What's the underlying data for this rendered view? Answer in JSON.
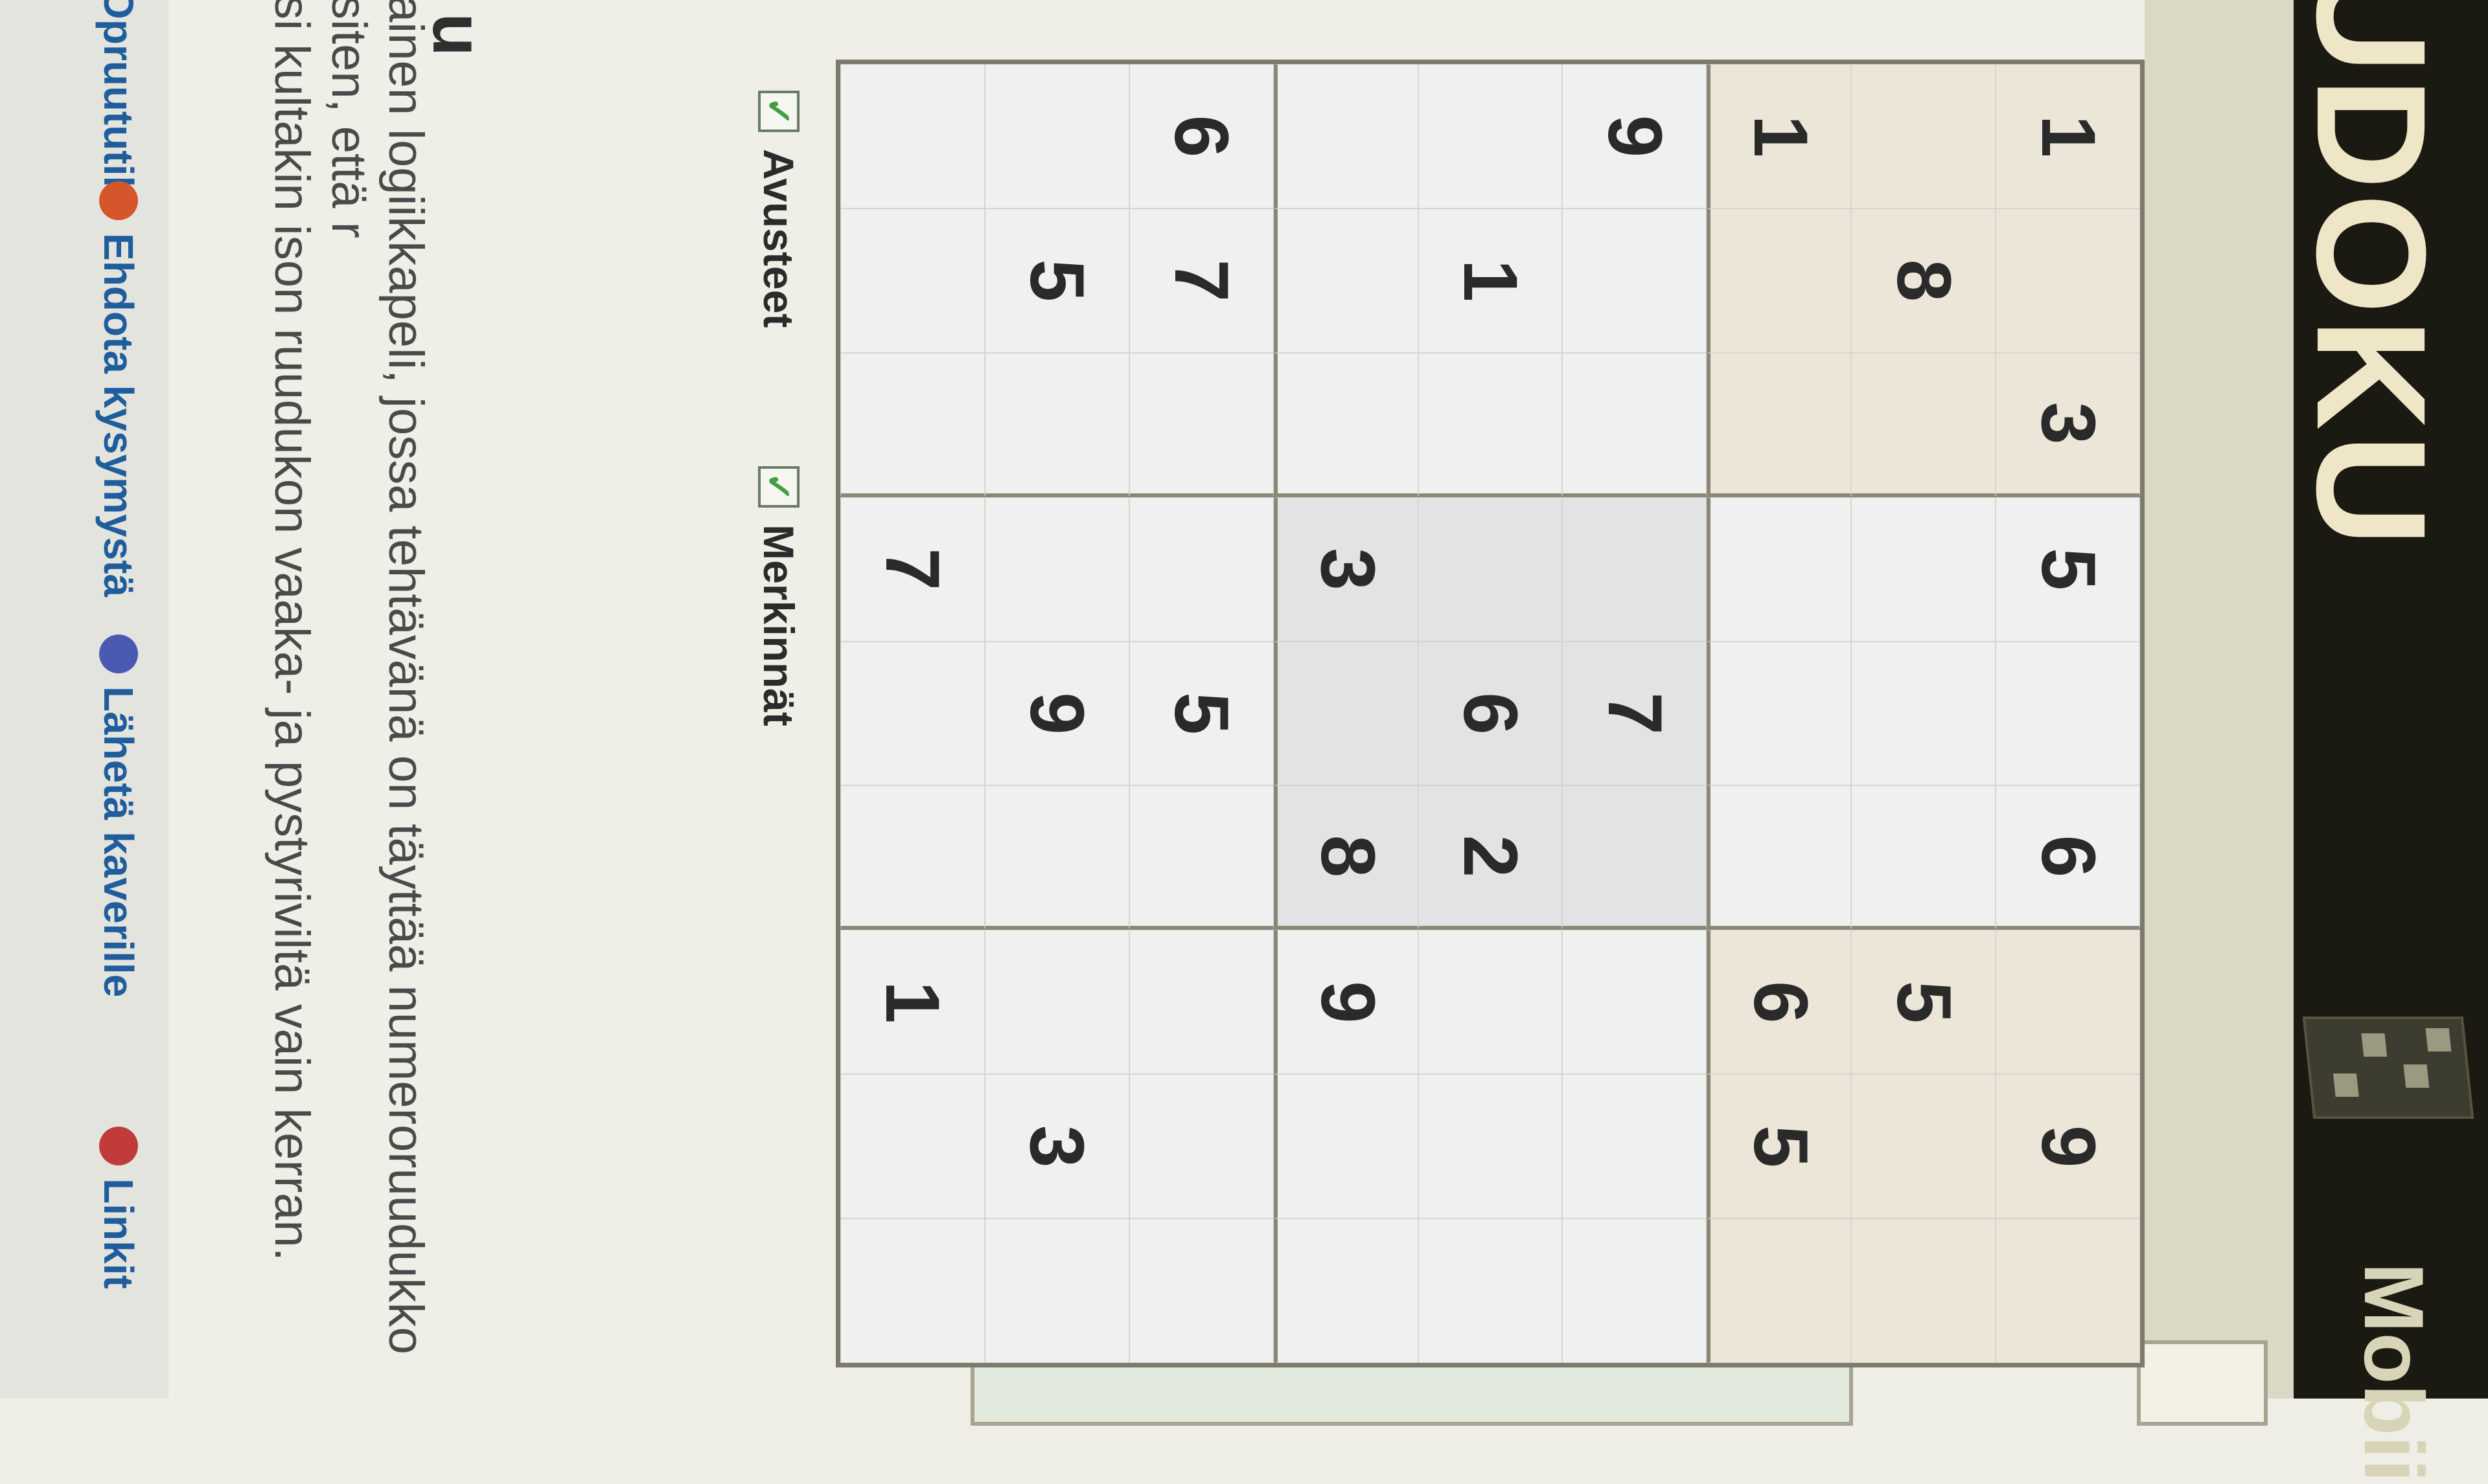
{
  "header": {
    "logo_text": "UDOKU",
    "right_text": "Mobii"
  },
  "board": {
    "cells": [
      [
        "",
        "",
        "",
        "",
        "",
        "",
        "",
        "",
        ""
      ],
      [
        "",
        "",
        "",
        "",
        "",
        "",
        "",
        "",
        ""
      ],
      [
        "",
        "",
        "",
        "",
        "",
        "",
        "",
        "",
        ""
      ],
      [
        "",
        "",
        "",
        "",
        "",
        "",
        "",
        "",
        ""
      ],
      [
        "",
        "",
        "",
        "",
        "",
        "",
        "",
        "",
        ""
      ],
      [
        "",
        "",
        "",
        "",
        "",
        "",
        "",
        "",
        ""
      ],
      [
        "",
        "",
        "",
        "",
        "",
        "",
        "",
        "",
        ""
      ],
      [
        "",
        "",
        "",
        "",
        "",
        "",
        "",
        "",
        ""
      ],
      [
        "",
        "",
        "",
        "",
        "",
        "",
        "",
        "",
        ""
      ]
    ],
    "rows": [
      [
        "1",
        "",
        "3",
        "5",
        "",
        "6",
        "",
        "9",
        ""
      ],
      [
        "",
        "8",
        "",
        "",
        "",
        "",
        "5",
        "",
        ""
      ],
      [
        "1",
        "",
        "",
        "",
        "",
        "",
        "6",
        "5",
        ""
      ],
      [
        "9",
        "",
        "",
        "",
        "7",
        "",
        "",
        "",
        ""
      ],
      [
        "",
        "1",
        "",
        "",
        "6",
        "2",
        "",
        "",
        ""
      ],
      [
        "",
        "",
        "",
        "3",
        "",
        "8",
        "9",
        "",
        ""
      ],
      [
        "6",
        "7",
        "",
        "",
        "5",
        "",
        "",
        "",
        ""
      ],
      [
        "",
        "5",
        "",
        "",
        "9",
        "",
        "",
        "3",
        ""
      ],
      [
        "",
        "",
        "",
        "7",
        "",
        "",
        "1",
        "",
        ""
      ]
    ]
  },
  "options": {
    "avusteet_label": "Avusteet",
    "avusteet_checked": "✓",
    "merkinnat_label": "Merkinnät",
    "merkinnat_checked": "✓"
  },
  "description": {
    "title": "u",
    "line1": "ainen logiikkapeli, jossa tehtävänä on täyttää numeroruudukko siten, että r",
    "line2": "si kultakin ison ruudukon vaaka- ja pystyriviltä vain kerran."
  },
  "links": {
    "practice": "Opruututila",
    "suggest": "Ehdota kysymystä",
    "send": "Lähetä kaverille",
    "links": "Linkit"
  }
}
